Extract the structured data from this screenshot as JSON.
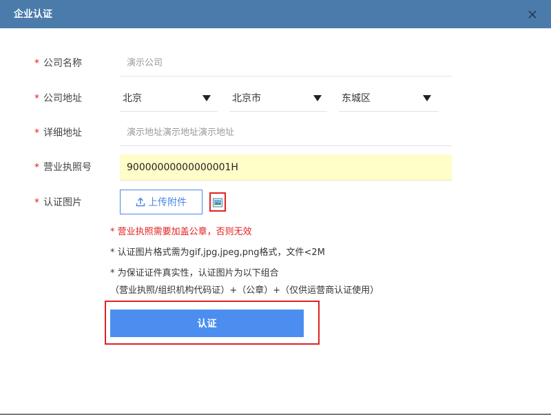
{
  "dialog": {
    "title": "企业认证",
    "close_icon": "close-icon"
  },
  "form": {
    "required_mark": "*",
    "company_name": {
      "label": "公司名称",
      "placeholder": "演示公司",
      "value": ""
    },
    "company_address": {
      "label": "公司地址",
      "province": "北京",
      "city": "北京市",
      "district": "东城区"
    },
    "detail_address": {
      "label": "详细地址",
      "placeholder": "演示地址演示地址演示地址",
      "value": ""
    },
    "license_no": {
      "label": "营业执照号",
      "value": "90000000000000001H"
    },
    "cert_image": {
      "label": "认证图片",
      "upload_label": "上传附件",
      "upload_icon": "upload-icon",
      "thumb_icon": "image-icon"
    }
  },
  "notes": {
    "stamp_warning": "* 营业执照需要加盖公章，否则无效",
    "format_rule": "* 认证图片格式需为gif,jpg,jpeg,png格式，文件<2M",
    "combo_rule_line1": "* 为保证证件真实性，认证图片为以下组合",
    "combo_rule_line2": "（营业执照/组织机构代码证）+（公章）+（仅供运营商认证使用）"
  },
  "submit": {
    "label": "认证"
  },
  "colors": {
    "titlebar": "#4a7bab",
    "required": "#e02020",
    "primary": "#4b8ef0",
    "highlight_input": "#fffdc8"
  }
}
